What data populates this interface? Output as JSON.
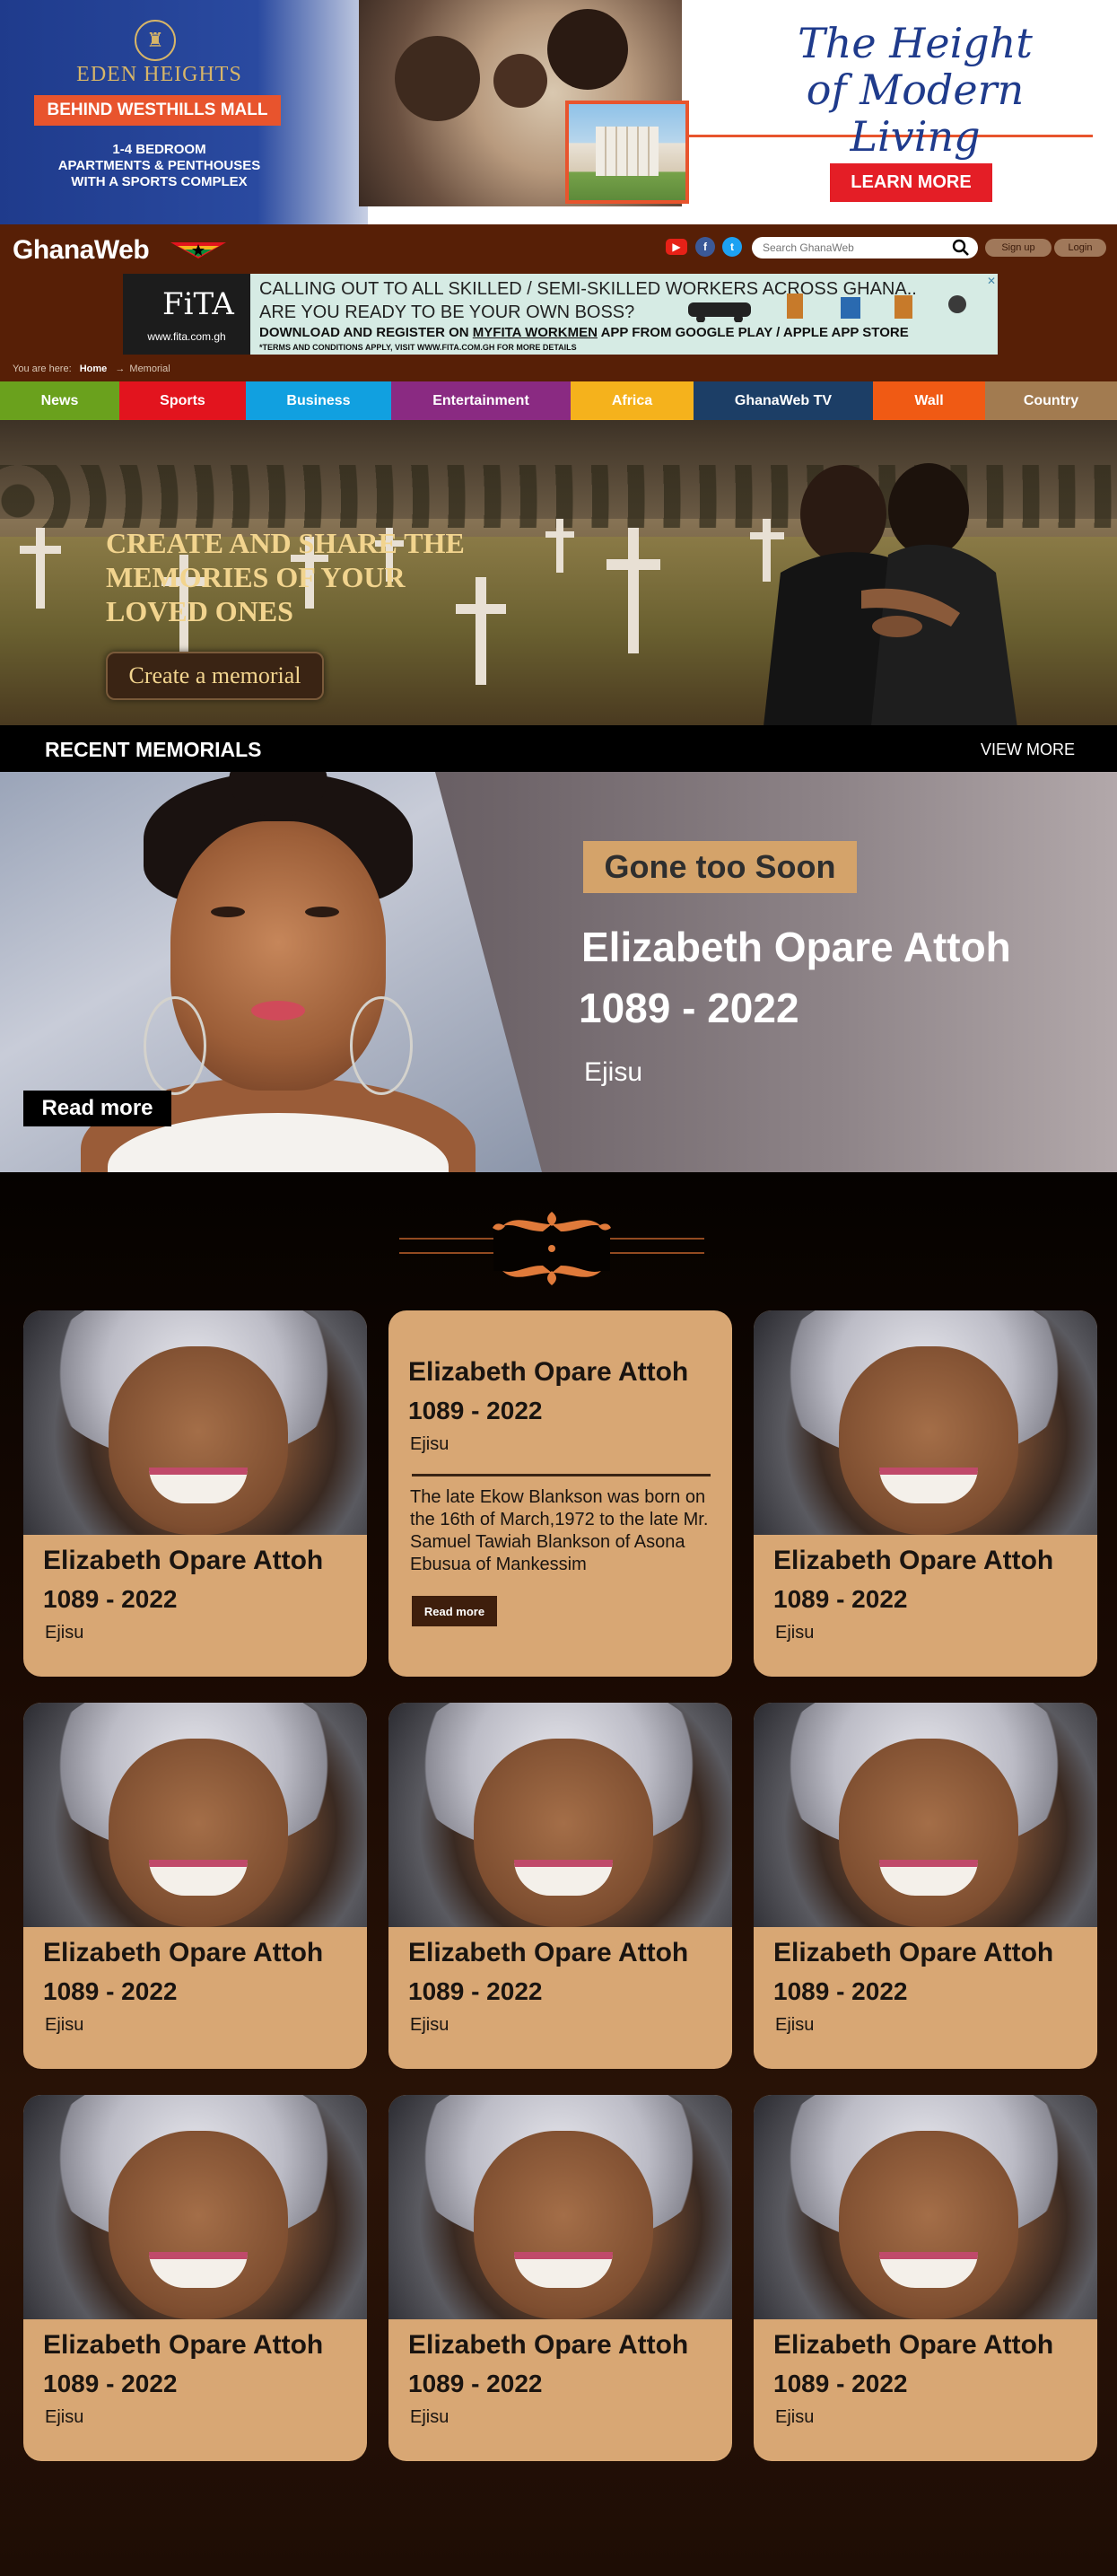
{
  "top_ad": {
    "brand": "EDEN HEIGHTS",
    "location": "BEHIND WESTHILLS MALL",
    "desc_lines": [
      "1-4 BEDROOM",
      "APARTMENTS & PENTHOUSES",
      "WITH A SPORTS COMPLEX"
    ],
    "tagline_1": "The Height",
    "tagline_2": "of Modern Living",
    "cta": "LEARN MORE",
    "colors": {
      "blue": "#1f3b8c",
      "orange": "#e8542d",
      "red": "#e41e26"
    }
  },
  "header": {
    "logo": "GhanaWeb",
    "search_placeholder": "Search GhanaWeb",
    "signup": "Sign up",
    "login": "Login",
    "social_icons": [
      "youtube-icon",
      "facebook-icon",
      "twitter-icon"
    ]
  },
  "fita_ad": {
    "logo_text": "FiTA",
    "logo_url": "www.fita.com.gh",
    "line1": "CALLING OUT TO ALL SKILLED / SEMI-SKILLED WORKERS ACROSS GHANA..",
    "line2": "ARE YOU READY TO BE YOUR OWN BOSS?",
    "line3_a": "DOWNLOAD AND REGISTER ON",
    "line3_b": "MYFITA WORKMEN",
    "line3_c": "APP FROM GOOGLE PLAY / APPLE APP STORE",
    "line4": "*TERMS AND CONDITIONS APPLY, VISIT WWW.FITA.COM.GH FOR MORE DETAILS"
  },
  "breadcrumb": {
    "label": "You are here:",
    "home": "Home",
    "sep": "→",
    "current": "Memorial"
  },
  "nav": [
    {
      "label": "News",
      "color": "#6aa11d"
    },
    {
      "label": "Sports",
      "color": "#e2141e"
    },
    {
      "label": "Business",
      "color": "#11a0e0"
    },
    {
      "label": "Entertainment",
      "color": "#8a2a82"
    },
    {
      "label": "Africa",
      "color": "#f5b21c"
    },
    {
      "label": "GhanaWeb TV",
      "color": "#1c3e66"
    },
    {
      "label": "Wall",
      "color": "#f05a14"
    },
    {
      "label": "Country",
      "color": "#a27b50"
    }
  ],
  "hero": {
    "title_lines": [
      "CREATE AND SHARE THE",
      "MEMORIES OF YOUR",
      "LOVED ONES"
    ],
    "cta": "Create a memorial"
  },
  "recent": {
    "title": "RECENT MEMORIALS",
    "view_more": "VIEW MORE"
  },
  "featured": {
    "tag": "Gone too Soon",
    "name": "Elizabeth Opare Attoh",
    "years": "1089 - 2022",
    "place": "Ejisu",
    "read_more": "Read more"
  },
  "cards": [
    {
      "name": "Elizabeth Opare Attoh",
      "years": "1089 - 2022",
      "place": "Ejisu"
    },
    {
      "name": "Elizabeth Opare Attoh",
      "years": "1089 - 2022",
      "place": "Ejisu",
      "desc": "The late Ekow Blankson was born on the 16th of March,1972 to the late Mr. Samuel Tawiah Blankson of Asona Ebusua of Mankessim",
      "read_more": "Read more"
    },
    {
      "name": "Elizabeth Opare Attoh",
      "years": "1089 - 2022",
      "place": "Ejisu"
    },
    {
      "name": "Elizabeth Opare Attoh",
      "years": "1089 - 2022",
      "place": "Ejisu"
    },
    {
      "name": "Elizabeth Opare Attoh",
      "years": "1089 - 2022",
      "place": "Ejisu"
    },
    {
      "name": "Elizabeth Opare Attoh",
      "years": "1089 - 2022",
      "place": "Ejisu"
    },
    {
      "name": "Elizabeth Opare Attoh",
      "years": "1089 - 2022",
      "place": "Ejisu"
    },
    {
      "name": "Elizabeth Opare Attoh",
      "years": "1089 - 2022",
      "place": "Ejisu"
    },
    {
      "name": "Elizabeth Opare Attoh",
      "years": "1089 - 2022",
      "place": "Ejisu"
    }
  ]
}
